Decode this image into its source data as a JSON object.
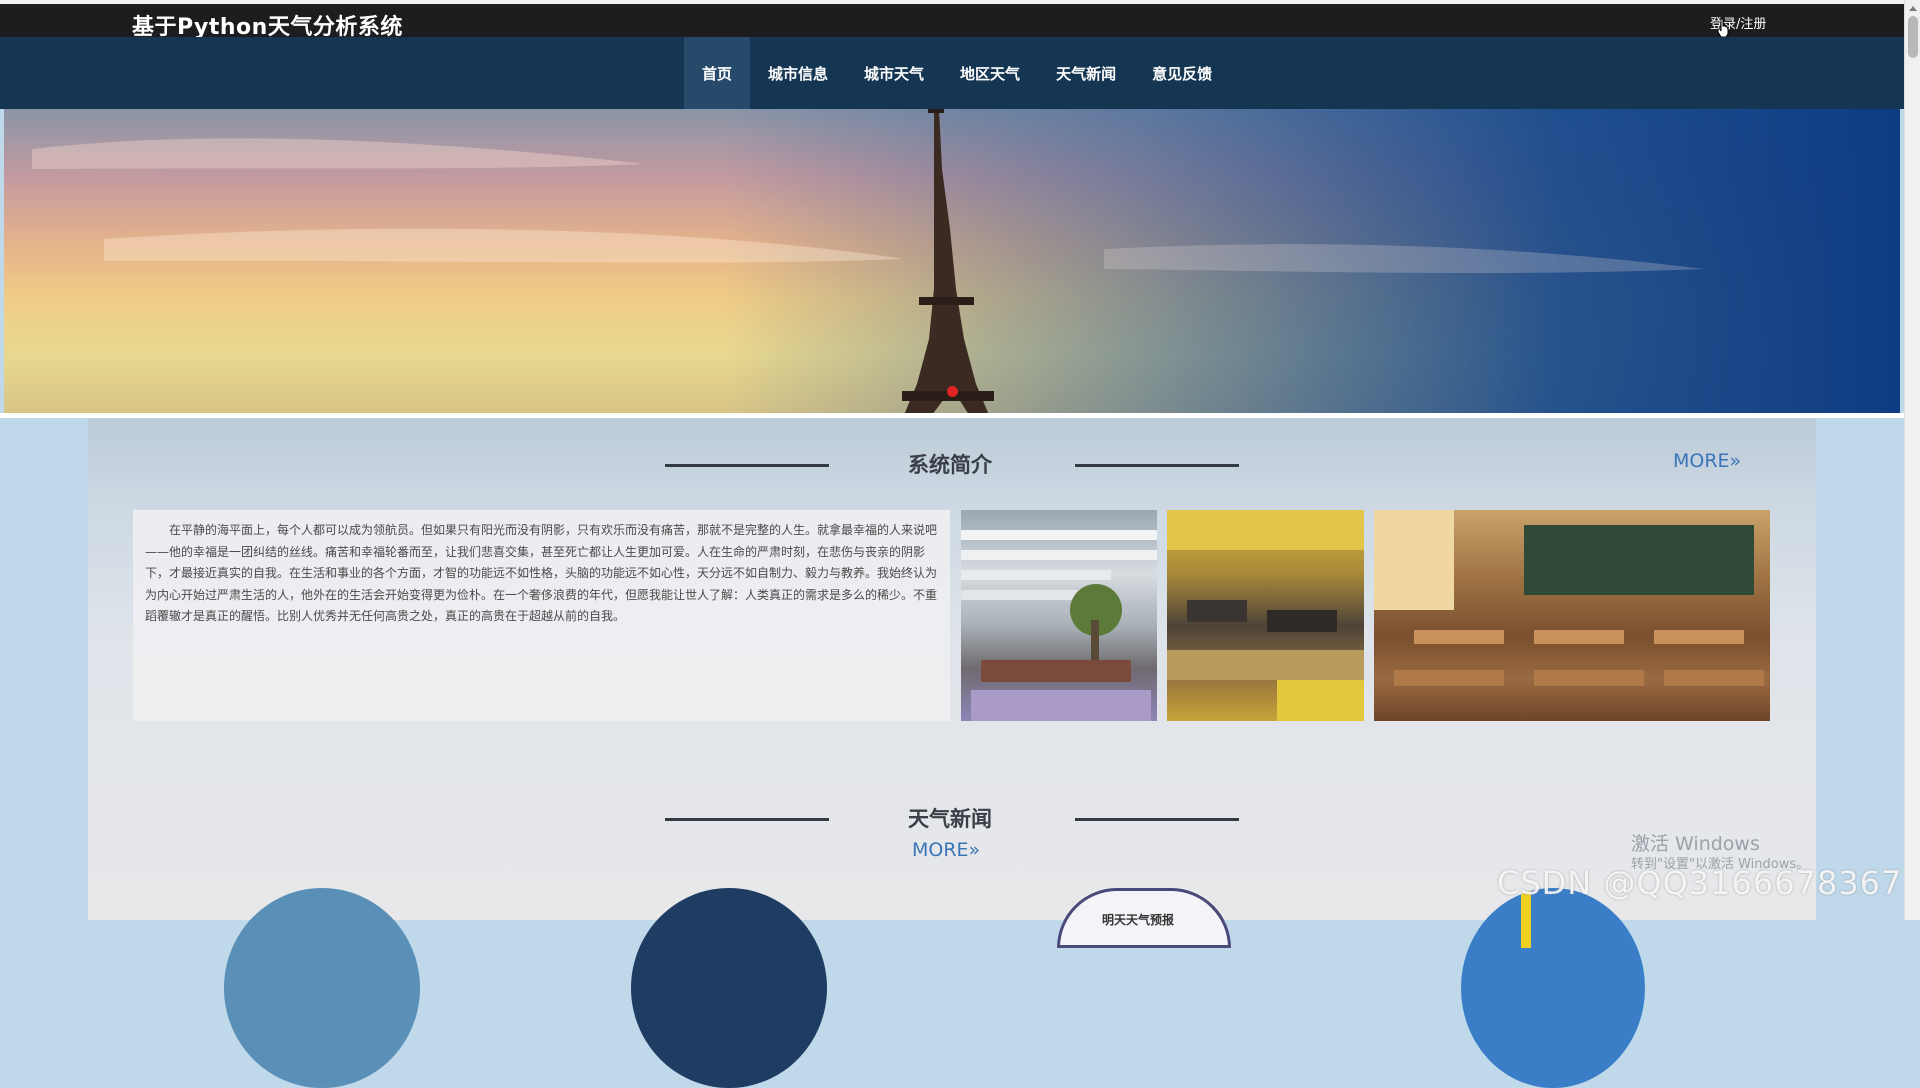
{
  "header": {
    "site_title": "基于Python天气分析系统",
    "login_label": "登录/注册"
  },
  "nav": {
    "items": [
      {
        "label": "首页",
        "active": true
      },
      {
        "label": "城市信息",
        "active": false
      },
      {
        "label": "城市天气",
        "active": false
      },
      {
        "label": "地区天气",
        "active": false
      },
      {
        "label": "天气新闻",
        "active": false
      },
      {
        "label": "意见反馈",
        "active": false
      }
    ]
  },
  "intro_section": {
    "title": "系统简介",
    "more_label": "MORE»",
    "text": "在平静的海平面上，每个人都可以成为领航员。但如果只有阳光而没有阴影，只有欢乐而没有痛苦，那就不是完整的人生。就拿最幸福的人来说吧——他的幸福是一团纠结的丝线。痛苦和幸福轮番而至，让我们悲喜交集，甚至死亡都让人生更加可爱。人在生命的严肃时刻，在悲伤与丧亲的阴影下，才最接近真实的自我。在生活和事业的各个方面，才智的功能远不如性格，头脑的功能远不如心性，天分远不如自制力、毅力与教养。我始终认为为内心开始过严肃生活的人，他外在的生活会开始变得更为俭朴。在一个奢侈浪费的年代，但愿我能让世人了解：人类真正的需求是多么的稀少。不重蹈覆辙才是真正的醒悟。比别人优秀并无任何高贵之处，真正的高贵在于超越从前的自我。"
  },
  "news_section": {
    "title": "天气新闻",
    "more_label": "MORE»",
    "partial_thumb_text": "明天天气预报"
  },
  "overlays": {
    "activate_windows": "激活 Windows",
    "activate_hint": "转到\"设置\"以激活 Windows。",
    "csdn_watermark": "CSDN @QQ3166678367"
  },
  "colors": {
    "topbar": "#1d1d1f",
    "navbar": "#143652",
    "nav_active": "#27496a",
    "more_link": "#3a74b8",
    "banner_dot": "#e02424"
  },
  "icons": {
    "cursor": "hand-pointer-icon",
    "more": "double-chevron-right-icon"
  }
}
